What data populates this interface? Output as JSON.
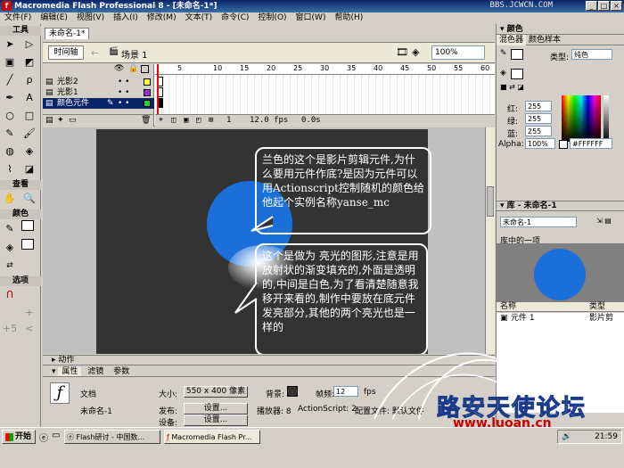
{
  "window": {
    "title": "Macromedia Flash Professional 8 - [未命名-1*]",
    "watermark": "BBS.JCWCN.COM"
  },
  "menu": [
    "文件(F)",
    "编辑(E)",
    "视图(V)",
    "插入(I)",
    "修改(M)",
    "文本(T)",
    "命令(C)",
    "控制(O)",
    "窗口(W)",
    "帮助(H)"
  ],
  "tools": {
    "header": "工具",
    "view_header": "查看",
    "color_header": "颜色",
    "options_header": "选项"
  },
  "document": {
    "tab": "未命名-1*",
    "timeline_button": "时间轴",
    "scene": "场景 1",
    "zoom": "100%"
  },
  "timeline": {
    "layers": [
      {
        "name": "光影2",
        "color": "#ffff33"
      },
      {
        "name": "光影1",
        "color": "#9933cc"
      },
      {
        "name": "颜色元件",
        "color": "#33cc33"
      }
    ],
    "frame_numbers": [
      "5",
      "10",
      "15",
      "20",
      "25",
      "30",
      "35",
      "40",
      "45",
      "50",
      "55",
      "60",
      "65"
    ],
    "current_frame": "1",
    "fps": "12.0 fps",
    "time": "0.0s"
  },
  "stage": {
    "background_color": "#333333",
    "circle_color": "#1a6fd9",
    "bubble1": "兰色的这个是影片剪辑元件,为什么要用元件作底?是因为元件可以用Actionscript控制随机的颜色给他起个实例名称yanse_mc",
    "bubble2": "这个是做为 亮光的图形,注意是用放射状的渐变填充的,外面是透明的,中间是白色,为了看清楚随意我移开来看的,制作中要放在底元件发亮部分,其他的两个亮光也是一样的"
  },
  "color_panel": {
    "title": "颜色",
    "tab_mixer": "混色器",
    "tab_swatches": "颜色样本",
    "type_label": "类型:",
    "type_value": "纯色",
    "red_label": "红:",
    "red_value": "255",
    "green_label": "绿:",
    "green_value": "255",
    "blue_label": "蓝:",
    "blue_value": "255",
    "alpha_label": "Alpha:",
    "alpha_value": "100%",
    "hex_value": "#FFFFFF"
  },
  "library": {
    "title": "库 - 未命名-1",
    "dropdown": "未命名-1",
    "item_caption": "库中的一项",
    "col_name": "名称",
    "col_type": "类型",
    "item_name": "元件 1",
    "item_type": "影片剪"
  },
  "properties": {
    "tab_actions": "动作",
    "tab_props": "属性",
    "tab_filters": "滤镜",
    "tab_params": "参数",
    "doc_label": "文档",
    "doc_name": "未命名-1",
    "size_label": "大小:",
    "size_value": "550 x 400 像素",
    "bg_label": "背景:",
    "fps_label": "帧频:",
    "fps_value": "12",
    "fps_unit": "fps",
    "publish_label": "发布:",
    "settings_button": "设置...",
    "player_label": "播放器: 8",
    "as_label": "ActionScript: 2",
    "profile_label": "配置文件: 默认文件",
    "device_label": "设备:",
    "device_button": "设置..."
  },
  "taskbar": {
    "start": "开始",
    "task1": "Flash研讨 - 中国数...",
    "task2": "Macromedia Flash Pr...",
    "clock": "21:59"
  },
  "watermarks": {
    "forum": "路安天使论坛",
    "url": "www.luoan.cn"
  }
}
